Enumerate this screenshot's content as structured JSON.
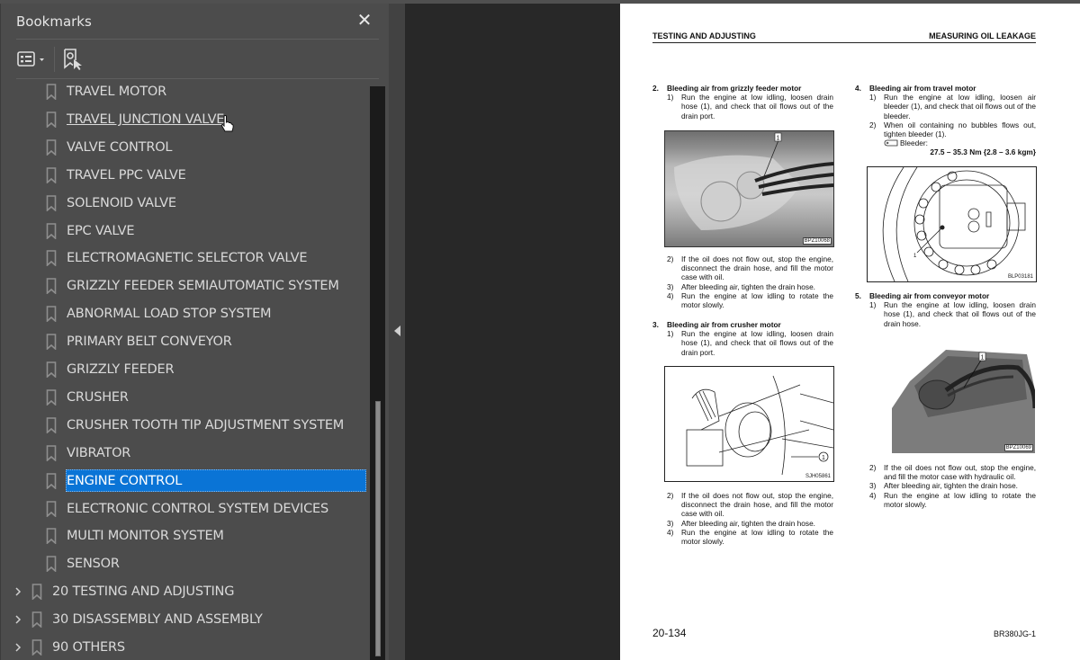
{
  "bookmarks_panel": {
    "title": "Bookmarks",
    "close_label": "✕",
    "items": [
      {
        "label": "TRAVEL MOTOR",
        "level": 2
      },
      {
        "label": "TRAVEL JUNCTION VALVE",
        "level": 2,
        "state": "hover"
      },
      {
        "label": "VALVE CONTROL",
        "level": 2
      },
      {
        "label": "TRAVEL PPC VALVE",
        "level": 2
      },
      {
        "label": "SOLENOID VALVE",
        "level": 2
      },
      {
        "label": "EPC VALVE",
        "level": 2
      },
      {
        "label": "ELECTROMAGNETIC SELECTOR VALVE",
        "level": 2
      },
      {
        "label": "GRIZZLY FEEDER SEMIAUTOMATIC SYSTEM",
        "level": 2
      },
      {
        "label": "ABNORMAL LOAD STOP SYSTEM",
        "level": 2
      },
      {
        "label": "PRIMARY BELT CONVEYOR",
        "level": 2
      },
      {
        "label": "GRIZZLY FEEDER",
        "level": 2
      },
      {
        "label": "CRUSHER",
        "level": 2
      },
      {
        "label": "CRUSHER TOOTH TIP ADJUSTMENT SYSTEM",
        "level": 2
      },
      {
        "label": "VIBRATOR",
        "level": 2
      },
      {
        "label": "ENGINE CONTROL",
        "level": 2,
        "state": "selected"
      },
      {
        "label": "ELECTRONIC CONTROL SYSTEM DEVICES",
        "level": 2
      },
      {
        "label": "MULTI MONITOR SYSTEM",
        "level": 2
      },
      {
        "label": "SENSOR",
        "level": 2
      },
      {
        "label": "20 TESTING AND ADJUSTING",
        "level": 1,
        "expandable": true
      },
      {
        "label": "30 DISASSEMBLY AND ASSEMBLY",
        "level": 1,
        "expandable": true
      },
      {
        "label": "90 OTHERS",
        "level": 1,
        "expandable": true
      }
    ],
    "scroll_position_fraction": 0.55
  },
  "document": {
    "header_left": "TESTING AND ADJUSTING",
    "header_right": "MEASURING OIL LEAKAGE",
    "sections": {
      "s2": {
        "num": "2.",
        "title": "Bleeding air from grizzly feeder motor",
        "step1": {
          "n": "1)",
          "text": "Run the engine at low idling, loosen drain hose (1), and check that oil flows out of the drain port."
        },
        "figure_code": "BPZ10068",
        "figure_callout": "1",
        "step2": {
          "n": "2)",
          "text": "If the oil does not flow out, stop the engine, disconnect the drain hose, and fill the motor case with oil."
        },
        "step3": {
          "n": "3)",
          "text": "After bleeding air, tighten the drain hose."
        },
        "step4": {
          "n": "4)",
          "text": "Run the engine at low idling to rotate the motor slowly."
        }
      },
      "s3": {
        "num": "3.",
        "title": "Bleeding air from crusher motor",
        "step1": {
          "n": "1)",
          "text": "Run the engine at low idling, loosen drain hose (1), and check that oil flows out of the drain port."
        },
        "figure_code": "SJH05861",
        "figure_callout": "1",
        "step2": {
          "n": "2)",
          "text": "If the oil does not flow out, stop the engine, disconnect the drain hose, and fill the motor case with oil."
        },
        "step3": {
          "n": "3)",
          "text": "After bleeding air, tighten the drain hose."
        },
        "step4": {
          "n": "4)",
          "text": "Run the engine at low idling to rotate the motor slowly."
        }
      },
      "s4": {
        "num": "4.",
        "title": "Bleeding air from travel motor",
        "step1": {
          "n": "1)",
          "text": "Run the engine at low idling, loosen air bleeder (1), and check that oil flows out of the bleeder."
        },
        "step2": {
          "n": "2)",
          "text": "When oil containing no bubbles flows out, tighten bleeder (1)."
        },
        "torque_label": "Bleeder:",
        "torque_value": "27.5 – 35.3 Nm {2.8 – 3.6 kgm}",
        "figure_code": "BLP03181",
        "figure_callout": "1"
      },
      "s5": {
        "num": "5.",
        "title": "Bleeding air from conveyor motor",
        "step1": {
          "n": "1)",
          "text": "Run the engine at low idling, loosen drain hose (1), and check that oil flows out of the drain hose."
        },
        "figure_code": "BPZ10069",
        "figure_callout": "1",
        "step2": {
          "n": "2)",
          "text": "If the oil does not flow out, stop the engine, and fill the motor case with hydraulic oil."
        },
        "step3": {
          "n": "3)",
          "text": "After bleeding air, tighten the drain hose."
        },
        "step4": {
          "n": "4)",
          "text": "Run the engine at low idling to rotate the motor slowly."
        }
      }
    },
    "page_number": "20-134",
    "model_code": "BR380JG-1"
  }
}
